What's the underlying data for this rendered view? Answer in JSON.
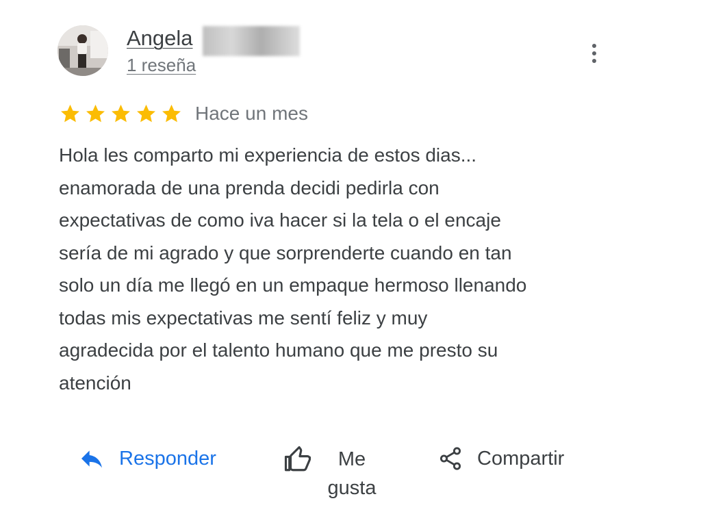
{
  "reviewer": {
    "name": "Angela",
    "review_count": "1 reseña",
    "avatar_icon": "user-photo"
  },
  "rating": {
    "stars": 5,
    "max": 5,
    "star_color": "#fbbc04",
    "date": "Hace un mes"
  },
  "review": {
    "text": "Hola les comparto mi experiencia de estos  dias...\nenamorada de una prenda decidi pedirla con\nexpectativas de como iva hacer si la tela o el encaje\nsería de mi agrado y que sorprenderte cuando en tan\nsolo un día me llegó en un empaque hermoso llenando\ntodas mis expectativas me sentí feliz y muy\nagradecida por el talento humano que me presto su\natención"
  },
  "actions": {
    "reply_label": "Responder",
    "like_label": "Me\ngusta",
    "share_label": "Compartir",
    "reply_icon": "reply-arrow-icon",
    "like_icon": "thumbs-up-icon",
    "share_icon": "share-icon",
    "accent_color": "#1a73e8"
  },
  "menu": {
    "icon": "more-vert-icon"
  }
}
